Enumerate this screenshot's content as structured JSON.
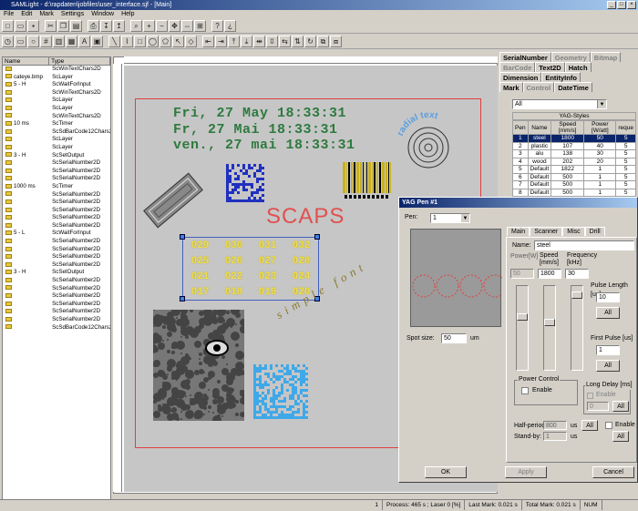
{
  "window": {
    "title": "SAMLight - d:\\rapdaten\\jobfiles\\user_interface.sjf - [Main]"
  },
  "menu": [
    "File",
    "Edit",
    "Mark",
    "Settings",
    "Window",
    "Help"
  ],
  "objlist": {
    "headers": [
      "Name",
      "Type"
    ],
    "rows": [
      {
        "name": "",
        "type": "ScWinTextChars2D"
      },
      {
        "name": "cateye.bmp",
        "type": "ScLayer"
      },
      {
        "name": "5 - H",
        "type": "ScWaitForInput"
      },
      {
        "name": "",
        "type": "ScWinTextChars2D"
      },
      {
        "name": "",
        "type": "ScLayer"
      },
      {
        "name": "",
        "type": "ScLayer"
      },
      {
        "name": "",
        "type": "ScWinTextChars2D"
      },
      {
        "name": "10 ms",
        "type": "ScTimer"
      },
      {
        "name": "",
        "type": "ScSdBarCode12Chars2D"
      },
      {
        "name": "",
        "type": "ScLayer"
      },
      {
        "name": "",
        "type": "ScLayer"
      },
      {
        "name": "3 - H",
        "type": "ScSetOutput"
      },
      {
        "name": "",
        "type": "ScSerialNumber2D"
      },
      {
        "name": "",
        "type": "ScSerialNumber2D"
      },
      {
        "name": "",
        "type": "ScSerialNumber2D"
      },
      {
        "name": "1000 ms",
        "type": "ScTimer"
      },
      {
        "name": "",
        "type": "ScSerialNumber2D"
      },
      {
        "name": "",
        "type": "ScSerialNumber2D"
      },
      {
        "name": "",
        "type": "ScSerialNumber2D"
      },
      {
        "name": "",
        "type": "ScSerialNumber2D"
      },
      {
        "name": "",
        "type": "ScSerialNumber2D"
      },
      {
        "name": "5 - L",
        "type": "ScWaitForInput"
      },
      {
        "name": "",
        "type": "ScSerialNumber2D"
      },
      {
        "name": "",
        "type": "ScSerialNumber2D"
      },
      {
        "name": "",
        "type": "ScSerialNumber2D"
      },
      {
        "name": "",
        "type": "ScSerialNumber2D"
      },
      {
        "name": "3 - H",
        "type": "ScSetOutput"
      },
      {
        "name": "",
        "type": "ScSerialNumber2D"
      },
      {
        "name": "",
        "type": "ScSerialNumber2D"
      },
      {
        "name": "",
        "type": "ScSerialNumber2D"
      },
      {
        "name": "",
        "type": "ScSerialNumber2D"
      },
      {
        "name": "",
        "type": "ScSerialNumber2D"
      },
      {
        "name": "",
        "type": "ScSerialNumber2D"
      },
      {
        "name": "",
        "type": "ScSdBarCode12Chars2D"
      }
    ]
  },
  "canvas": {
    "date1": "Fri, 27 May 18:33:31",
    "date2": "Fr, 27 Mai 18:33:31",
    "date3": "ven., 27 mai 18:33:31",
    "radial": "radial text",
    "scaps": "SCAPS",
    "simple_font": "simple font",
    "serials": [
      "029",
      "030",
      "031",
      "032",
      "025",
      "026",
      "027",
      "028",
      "021",
      "022",
      "023",
      "024",
      "017",
      "018",
      "019",
      "020"
    ]
  },
  "right": {
    "tabs_row1": [
      "SerialNumber",
      "Geometry",
      "Bitmap"
    ],
    "tabs_row2": [
      "BarCode",
      "Text2D",
      "Hatch"
    ],
    "tabs_row3": [
      "Dimension",
      "EntityInfo"
    ],
    "tabs_row4": [
      "Mark",
      "Control",
      "DateTime"
    ],
    "filter": "All",
    "table_title": "YAG-Styles",
    "table_headers": [
      "Pen",
      "Name",
      "Speed [mm/s]",
      "Power [W/att]",
      "reque"
    ],
    "rows": [
      [
        "1",
        "steel",
        "1800",
        "50",
        "5"
      ],
      [
        "2",
        "plastic",
        "107",
        "40",
        "5"
      ],
      [
        "3",
        "alu",
        "138",
        "30",
        "5"
      ],
      [
        "4",
        "wood",
        "202",
        "20",
        "5"
      ],
      [
        "5",
        "Default",
        "1822",
        "1",
        "5"
      ],
      [
        "6",
        "Default",
        "500",
        "1",
        "5"
      ],
      [
        "7",
        "Default",
        "500",
        "1",
        "5"
      ],
      [
        "8",
        "Default",
        "500",
        "1",
        "5"
      ],
      [
        "9",
        "Default",
        "500",
        "1",
        "5"
      ]
    ]
  },
  "dialog": {
    "title": "YAG Pen #1",
    "pen_label": "Pen:",
    "pen_value": "1",
    "tabs": [
      "Main",
      "Scanner",
      "Misc",
      "Drill"
    ],
    "name_label": "Name:",
    "name_value": "steel",
    "power_label": "Power[W]",
    "speed_label": "Speed [mm/s]",
    "freq_label": "Frequency [kHz]",
    "power_value": "50",
    "speed_value": "1800",
    "freq_value": "30",
    "pulse_length_label": "Pulse Length [us]",
    "pulse_length_value": "10",
    "all": "All",
    "first_pulse_label": "First Pulse [us]",
    "first_pulse_value": "1",
    "spot_label": "Spot size:",
    "spot_value": "50",
    "spot_unit": "um",
    "power_control": "Power Control",
    "enable": "Enable",
    "long_delay": "Long Delay [ms]",
    "long_delay_value": "0",
    "half_period_label": "Half-period:",
    "half_period_value": "800",
    "half_unit": "us",
    "standby_label": "Stand-by:",
    "standby_value": "1",
    "standby_unit": "us",
    "ok": "OK",
    "apply": "Apply",
    "cancel": "Cancel"
  },
  "status": {
    "s1": "1",
    "process": "Process: 465 s ; Laser 0 [%]",
    "last_mark": "Last Mark: 0.021 s",
    "total_mark": "Total Mark: 0.021 s",
    "num": "NUM"
  }
}
